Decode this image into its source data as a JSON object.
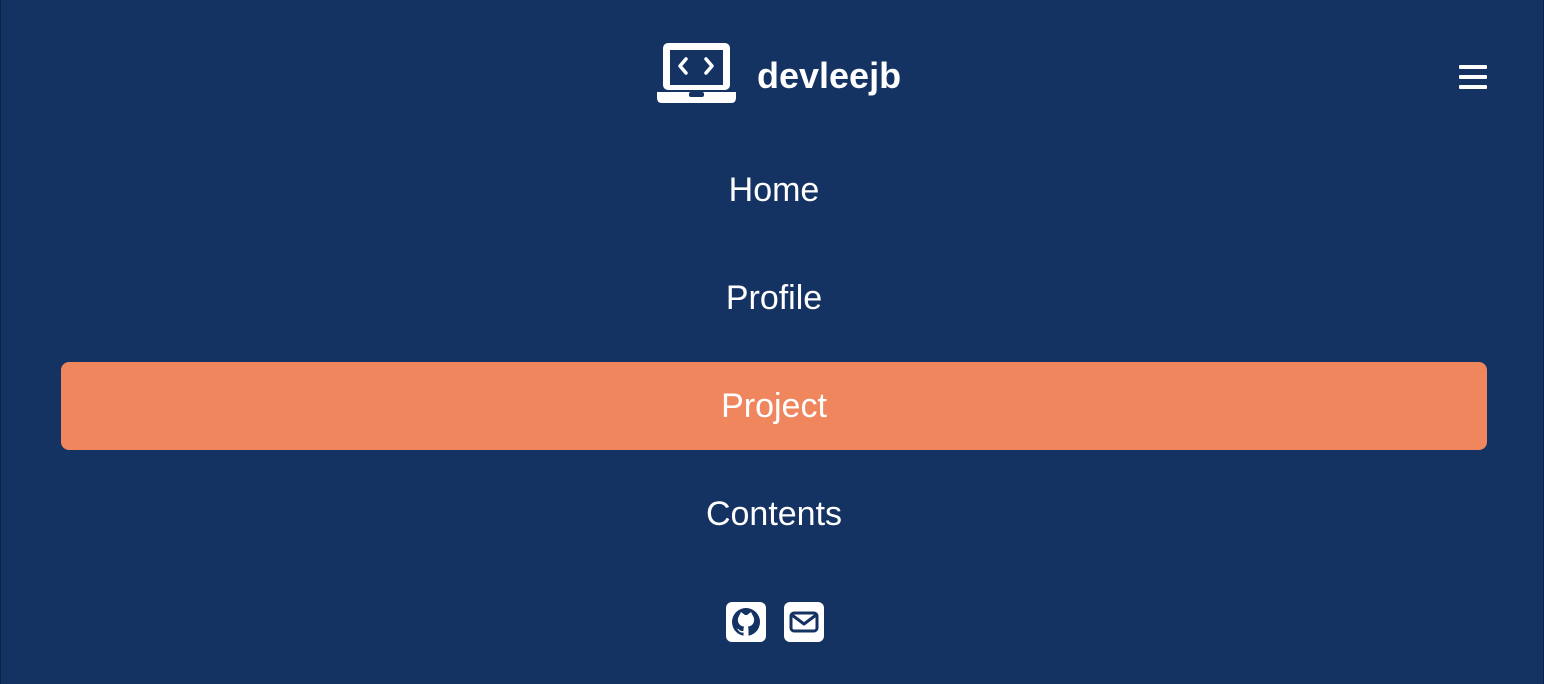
{
  "header": {
    "brand_name": "devleejb",
    "brand_icon": "laptop-code-icon",
    "menu_icon": "hamburger-menu-icon"
  },
  "nav": {
    "items": [
      {
        "label": "Home",
        "active": false
      },
      {
        "label": "Profile",
        "active": false
      },
      {
        "label": "Project",
        "active": true
      },
      {
        "label": "Contents",
        "active": false
      }
    ]
  },
  "social": {
    "icons": [
      "github-square-icon",
      "envelope-square-icon"
    ]
  },
  "colors": {
    "background": "#143262",
    "accent": "#ef865e",
    "text": "#ffffff"
  }
}
